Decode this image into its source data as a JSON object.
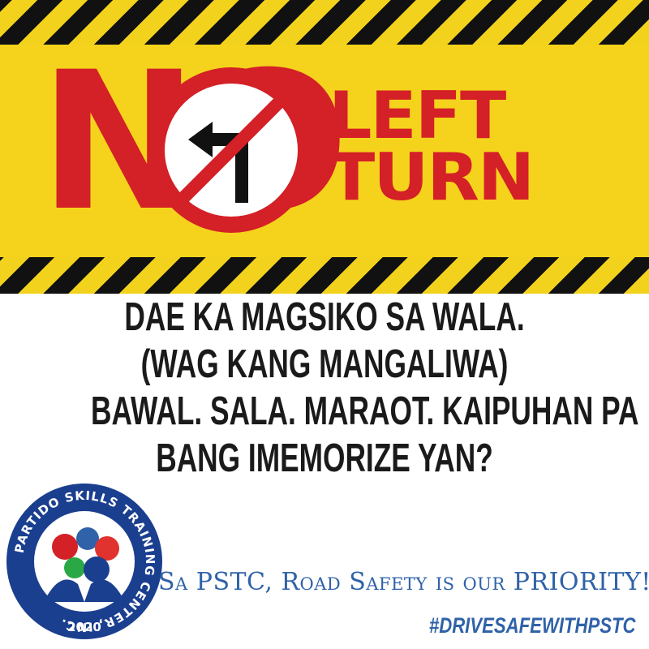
{
  "banner": {
    "word_no": "NO",
    "word_left": "LEFT",
    "word_turn": "TURN",
    "sign_icon": "no-left-turn-sign-icon",
    "colors": {
      "yellow": "#f5d31c",
      "red": "#d42027",
      "black": "#111111"
    }
  },
  "message": {
    "lines": [
      "DAE KA MAGSIKO SA WALA.",
      "(WAG KANG MANGALIWA)",
      "BAWAL. SALA. MARAOT. KAIPUHAN PA",
      "BANG IMEMORIZE YAN?"
    ]
  },
  "logo": {
    "ring_text": "PARTIDO SKILLS TRAINING CENTER, INC.",
    "year": "2020"
  },
  "tagline": "Sa PSTC, Road Safety is our PRIORITY!",
  "hashtag": "#DRIVESAFEWITHPSTC",
  "brand_color": "#2f62a8"
}
